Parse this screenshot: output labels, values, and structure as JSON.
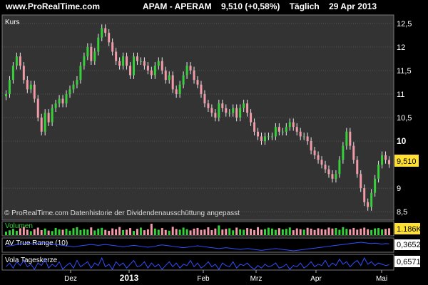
{
  "header": {
    "site": "www.ProRealTime.com",
    "symbol": "APAM - APERAM",
    "quote": "9,510 (+0,58%)",
    "period": "Täglich",
    "date": "29 Apr 2013"
  },
  "colors": {
    "up": "#36d13a",
    "down": "#f29aa8",
    "wick": "#e8e8e8",
    "panel_bg": "#333333",
    "grid": "#777777",
    "badge_last": "#ffe033"
  },
  "chart_data": [
    {
      "type": "candlestick",
      "panel_label": "Kurs",
      "ylim": [
        8.35,
        12.65
      ],
      "yticks": [
        "12,5",
        "12",
        "11,5",
        "11",
        "10,5",
        "10",
        "9",
        "8,5"
      ],
      "last_value": "9,510",
      "source_note": "© ProRealTime.com Datenhistorie der Dividendenausschüttung angepasst",
      "x_labels": [
        "Dez",
        "2013",
        "Feb",
        "Mrz",
        "Apr",
        "Mai"
      ],
      "close": [
        11.0,
        11.3,
        11.6,
        11.8,
        11.6,
        11.3,
        11.1,
        11.2,
        10.9,
        10.5,
        10.2,
        10.6,
        10.4,
        10.7,
        10.8,
        10.9,
        10.8,
        11.0,
        11.1,
        11.2,
        11.3,
        11.6,
        11.8,
        12.0,
        11.7,
        11.9,
        12.2,
        12.4,
        12.3,
        12.1,
        11.9,
        11.7,
        11.6,
        11.8,
        11.6,
        11.4,
        11.8,
        11.7,
        11.7,
        11.6,
        11.5,
        11.4,
        11.6,
        11.7,
        11.5,
        11.3,
        11.4,
        11.1,
        11.0,
        11.2,
        11.4,
        11.6,
        11.5,
        11.3,
        11.2,
        11.0,
        10.8,
        10.7,
        10.6,
        10.5,
        10.8,
        10.7,
        10.6,
        10.6,
        10.7,
        10.5,
        10.7,
        10.8,
        10.6,
        10.4,
        10.2,
        10.1,
        10.0,
        10.1,
        10.1,
        10.1,
        10.3,
        10.2,
        10.2,
        10.3,
        10.4,
        10.3,
        10.2,
        10.1,
        10.1,
        10.0,
        9.8,
        9.7,
        9.6,
        9.5,
        9.4,
        9.3,
        9.2,
        9.3,
        9.6,
        9.9,
        10.2,
        9.9,
        9.6,
        9.3,
        9.0,
        8.7,
        8.6,
        8.9,
        9.2,
        9.5,
        9.7,
        9.6,
        9.51
      ]
    },
    {
      "type": "bar",
      "panel_label": "Volumen",
      "last_value": "1.186K",
      "values": [
        30,
        42,
        55,
        38,
        60,
        72,
        48,
        35,
        52,
        66,
        44,
        58,
        40,
        36,
        63,
        50,
        47,
        55,
        39,
        61,
        70,
        45,
        53,
        49,
        68,
        41,
        57,
        64,
        46,
        38,
        59,
        52,
        71,
        44,
        48,
        62,
        37,
        55,
        66,
        43,
        51,
        100,
        58,
        47,
        62,
        45,
        39,
        73,
        54,
        48,
        66,
        52,
        41,
        57,
        63,
        46,
        50,
        69,
        44,
        58,
        85,
        49,
        55,
        60,
        42,
        66,
        51,
        47,
        62,
        56,
        44,
        70,
        48,
        53,
        65,
        58,
        46,
        61,
        50,
        55,
        67,
        43,
        59,
        52,
        48,
        64,
        57,
        45,
        60,
        53,
        49,
        66,
        58,
        62,
        47,
        70,
        55,
        51,
        63,
        48,
        57,
        66,
        52,
        45,
        59,
        62,
        50,
        55,
        60
      ]
    },
    {
      "type": "line",
      "panel_label": "AV True Range (10)",
      "last_value": "0,3652",
      "values": [
        0.31,
        0.32,
        0.33,
        0.35,
        0.36,
        0.37,
        0.38,
        0.37,
        0.36,
        0.38,
        0.39,
        0.38,
        0.37,
        0.36,
        0.35,
        0.34,
        0.33,
        0.32,
        0.31,
        0.3,
        0.31,
        0.32,
        0.33,
        0.34,
        0.35,
        0.34,
        0.33,
        0.34,
        0.35,
        0.34,
        0.33,
        0.32,
        0.31,
        0.3,
        0.31,
        0.32,
        0.33,
        0.32,
        0.31,
        0.3,
        0.29,
        0.3,
        0.31,
        0.33,
        0.34,
        0.33,
        0.32,
        0.31,
        0.3,
        0.29,
        0.28,
        0.29,
        0.3,
        0.31,
        0.32,
        0.31,
        0.3,
        0.29,
        0.28,
        0.27,
        0.26,
        0.27,
        0.28,
        0.27,
        0.26,
        0.25,
        0.24,
        0.25,
        0.26,
        0.25,
        0.24,
        0.23,
        0.22,
        0.23,
        0.24,
        0.25,
        0.26,
        0.25,
        0.24,
        0.23,
        0.22,
        0.21,
        0.22,
        0.23,
        0.24,
        0.25,
        0.26,
        0.27,
        0.28,
        0.29,
        0.3,
        0.31,
        0.32,
        0.33,
        0.34,
        0.35,
        0.36,
        0.37,
        0.38,
        0.39,
        0.4,
        0.39,
        0.38,
        0.37,
        0.38,
        0.37,
        0.36,
        0.37,
        0.3652
      ]
    },
    {
      "type": "line",
      "panel_label": "Vola Tageskerze",
      "last_value": "0,6571",
      "values": [
        0.5,
        0.8,
        0.4,
        0.9,
        0.6,
        1.0,
        0.5,
        0.7,
        0.3,
        0.8,
        0.6,
        1.1,
        0.4,
        0.7,
        0.5,
        0.9,
        0.3,
        0.6,
        0.8,
        0.4,
        1.0,
        0.5,
        0.7,
        0.9,
        0.4,
        0.8,
        0.6,
        1.2,
        0.5,
        0.7,
        0.3,
        0.9,
        0.6,
        0.8,
        0.4,
        0.7,
        1.0,
        0.5,
        0.6,
        0.9,
        0.4,
        0.8,
        0.5,
        0.7,
        0.3,
        0.6,
        0.9,
        0.5,
        0.8,
        0.4,
        0.7,
        0.6,
        1.0,
        0.5,
        0.8,
        0.4,
        0.6,
        0.9,
        0.5,
        0.7,
        0.3,
        0.8,
        0.6,
        0.5,
        0.9,
        0.4,
        0.7,
        0.6,
        0.8,
        0.5,
        0.3,
        0.6,
        0.4,
        0.7,
        0.5,
        0.6,
        0.8,
        0.4,
        0.5,
        0.7,
        0.3,
        0.6,
        0.5,
        0.8,
        0.4,
        0.6,
        0.9,
        0.5,
        0.7,
        0.6,
        1.0,
        0.5,
        0.8,
        0.6,
        1.1,
        0.7,
        0.9,
        0.5,
        0.8,
        1.0,
        0.6,
        1.2,
        0.7,
        0.9,
        0.6,
        0.8,
        0.7,
        0.6,
        0.6571
      ]
    }
  ]
}
